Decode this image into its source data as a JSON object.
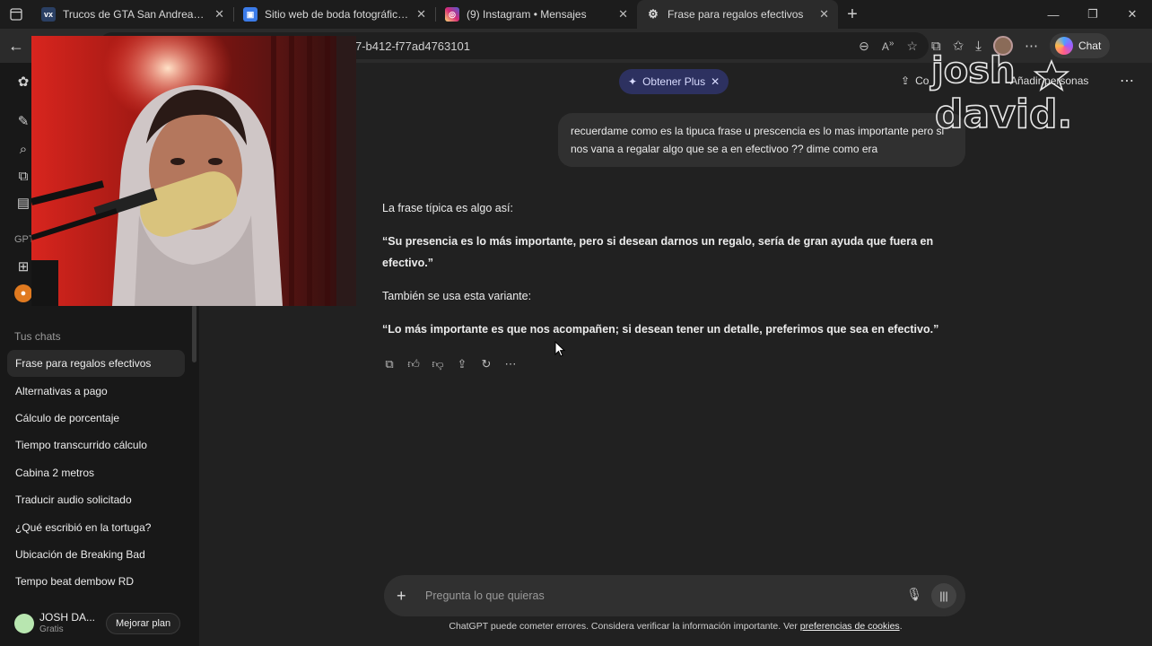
{
  "tabs": [
    {
      "title": "Trucos de GTA San Andreas para PC",
      "favicon": "vx",
      "favicon_color": "#2a3f63"
    },
    {
      "title": "Sitio web de boda fotográfico en",
      "favicon": "site",
      "favicon_color": "#3b7be8"
    },
    {
      "title": "(9) Instagram • Mensajes",
      "favicon": "instagram",
      "favicon_color": "#d62976"
    },
    {
      "title": "Frase para regalos efectivos",
      "favicon": "chatgpt",
      "favicon_color": "#2b2b2b"
    }
  ],
  "address": {
    "url": "7-b412-f77ad4763101"
  },
  "toolbar": {
    "copilot_label": "Chat"
  },
  "sidebar": {
    "gpt_label": "GPT",
    "chats_heading": "Tus chats",
    "chats": [
      "Frase para regalos efectivos",
      "Alternativas a pago",
      "Cálculo de porcentaje",
      "Tiempo transcurrido cálculo",
      "Cabina 2 metros",
      "Traducir audio solicitado",
      "¿Qué escribió en la tortuga?",
      "Ubicación de Breaking Bad",
      "Tempo beat dembow RD"
    ],
    "user_name": "JOSH DA...",
    "user_plan": "Gratis",
    "upgrade_label": "Mejorar plan"
  },
  "header": {
    "plus_label": "Obtener Plus",
    "share_label": "Co",
    "invite_label": "Añadir personas"
  },
  "conversation": {
    "user_message": "recuerdame como es la tipuca frase u prescencia es lo mas importante pero si nos vana a regalar algo que se a en efectivoo ?? dime como era",
    "answer": [
      {
        "text": "La frase típica es algo así:",
        "bold": false
      },
      {
        "text": "“Su presencia es lo más importante, pero si desean darnos un regalo, sería de gran ayuda que fuera en efectivo.”",
        "bold": true
      },
      {
        "text": "También se usa esta variante:",
        "bold": false
      },
      {
        "text": "“Lo más importante es que nos acompañen; si desean tener un detalle, preferimos que sea en efectivo.”",
        "bold": true
      }
    ]
  },
  "composer": {
    "placeholder": "Pregunta lo que quieras"
  },
  "footer": {
    "disclaimer": "ChatGPT puede cometer errores. Considera verificar la información importante. Ver ",
    "link": "preferencias de cookies",
    "end": "."
  },
  "overlay": {
    "watermark_line1": "josh",
    "watermark_line2": "david."
  }
}
